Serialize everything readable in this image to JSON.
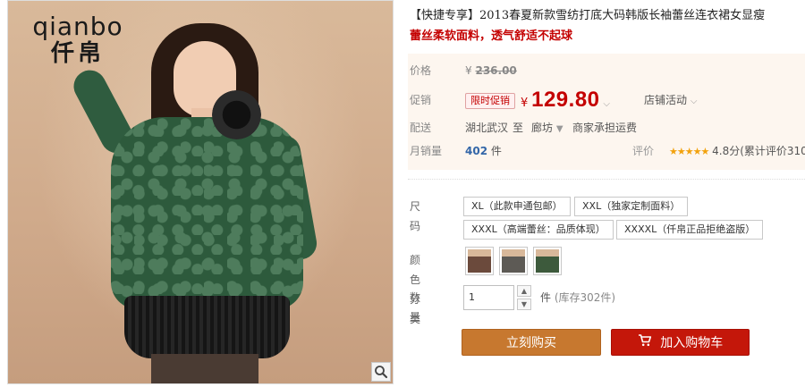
{
  "photo": {
    "brand_latin": "qianbo",
    "brand_cn": "仟帛",
    "zoom_icon": "magnifier-icon"
  },
  "product": {
    "title": "【快捷专享】2013春夏新款雪纺打底大码韩版长袖蕾丝连衣裙女显瘦",
    "subtitle": "蕾丝柔软面料，透气舒适不起球"
  },
  "pricing": {
    "price_label": "价格",
    "currency": "¥",
    "original_price": "236.00",
    "promo_label": "促销",
    "promo_badge": "限时促销",
    "promo_price": "129.80",
    "store_activity": "店铺活动",
    "shipping_label": "配送",
    "ship_from": "湖北武汉",
    "ship_to_word": "至",
    "ship_to": "廊坊",
    "ship_service": "商家承担运费",
    "sales_label": "月销量",
    "sales_value": "402",
    "sales_unit": "件",
    "rating_label": "评价",
    "rating_stars": "★★★★★",
    "rating_text": "4.8分(累计评价310"
  },
  "options": {
    "size_label": "尺码",
    "sizes": [
      "XL（此款申通包邮）",
      "XXL（独家定制面料）",
      "XXXL（高端蕾丝：品质体现）",
      "XXXXL（仟帛正品拒绝盗版）"
    ],
    "color_label": "颜色分类",
    "qty_label": "数量",
    "qty_value": "1",
    "qty_unit": "件",
    "stock_text": "(库存302件)"
  },
  "actions": {
    "buy_now": "立刻购买",
    "add_to_cart": "加入购物车"
  },
  "colors": {
    "price_red": "#c40000",
    "buy_button": "#c7782f",
    "cart_button": "#c4170a",
    "price_box_bg": "#fdf6ef"
  }
}
